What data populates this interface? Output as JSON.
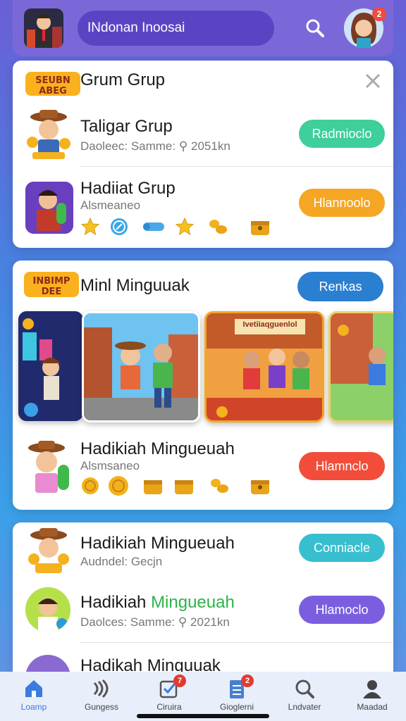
{
  "header": {
    "search_text": "INdonan Inoosai",
    "notification_count": "2"
  },
  "card1": {
    "title": "Grum Grup",
    "logo_text": "SEUBN ABEG",
    "items": [
      {
        "title": "Taligar Grup",
        "subtitle": "Daoleec: Samme: ⚲ 2051kn",
        "button": "Radmioclo",
        "button_color": "#3fcf9a"
      },
      {
        "title": "Hadiiat Grup",
        "subtitle": "Alsmeaneo",
        "button": "Hlannoolo",
        "button_color": "#f5a623"
      }
    ]
  },
  "card2": {
    "title": "Minl Minguuak",
    "logo_text": "INBIMP DEE",
    "header_button": "Renkas",
    "header_button_color": "#2b7fd1",
    "banner_text": "Ivetiiaqguenlol",
    "item": {
      "title": "Hadikiah Mingueuah",
      "subtitle": "Alsmsaneo",
      "button": "Hlamnclo",
      "button_color": "#f24d3a"
    }
  },
  "card3": {
    "items": [
      {
        "title": "Hadikiah Mingueuah",
        "subtitle": "Audndel: Gecjn",
        "button": "Conniacle",
        "button_color": "#37bfd0"
      },
      {
        "title_prefix": "Hadikiah ",
        "title_highlight": "Mingueuah",
        "highlight_color": "#2bb34a",
        "subtitle": "Daolces: Samme: ⚲ 2021kn",
        "button": "Hlamoclo",
        "button_color": "#7b5ee0"
      },
      {
        "title": "Hadikah Minguuak"
      }
    ]
  },
  "bottom_nav": [
    {
      "label": "Loamp",
      "icon": "home-icon",
      "active": true
    },
    {
      "label": "Gungess",
      "icon": "signal-icon"
    },
    {
      "label": "Ciruira",
      "icon": "checklist-icon",
      "badge": "7"
    },
    {
      "label": "Gioglerni",
      "icon": "notebook-icon",
      "badge": "2"
    },
    {
      "label": "Lndvater",
      "icon": "search-icon"
    },
    {
      "label": "Maadad",
      "icon": "profile-icon"
    }
  ]
}
